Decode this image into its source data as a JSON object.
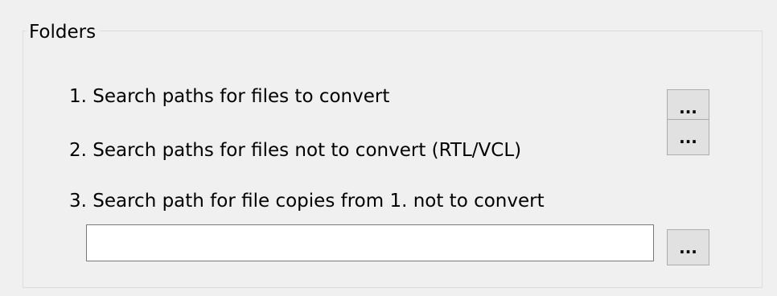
{
  "folders": {
    "title": "Folders",
    "items": [
      {
        "label": "1. Search paths for files to convert",
        "button_label": "..."
      },
      {
        "label": "2. Search paths for files not to convert (RTL/VCL)",
        "button_label": "..."
      },
      {
        "label": "3. Search path for file copies from 1. not to convert",
        "button_label": "..."
      }
    ],
    "copy_path": {
      "value": "",
      "placeholder": ""
    }
  }
}
